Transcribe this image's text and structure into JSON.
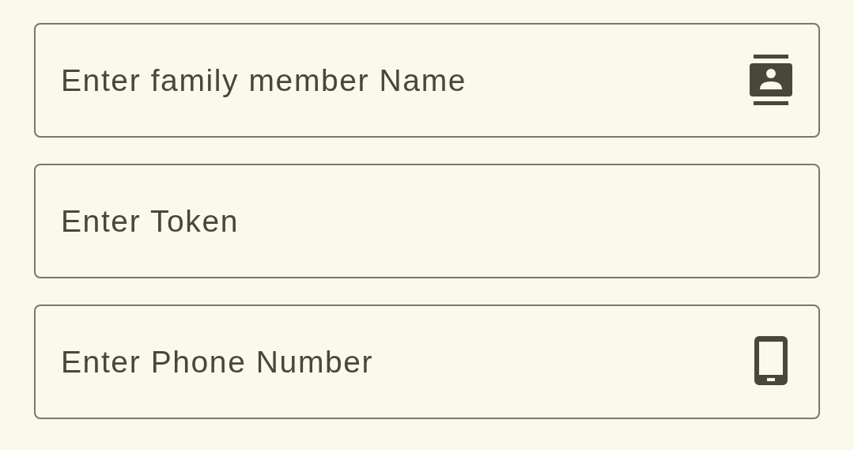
{
  "fields": [
    {
      "placeholder": "Enter family member Name",
      "kind": "contact"
    },
    {
      "placeholder": "Enter Token",
      "kind": "plain"
    },
    {
      "placeholder": "Enter Phone Number",
      "kind": "phone"
    }
  ]
}
